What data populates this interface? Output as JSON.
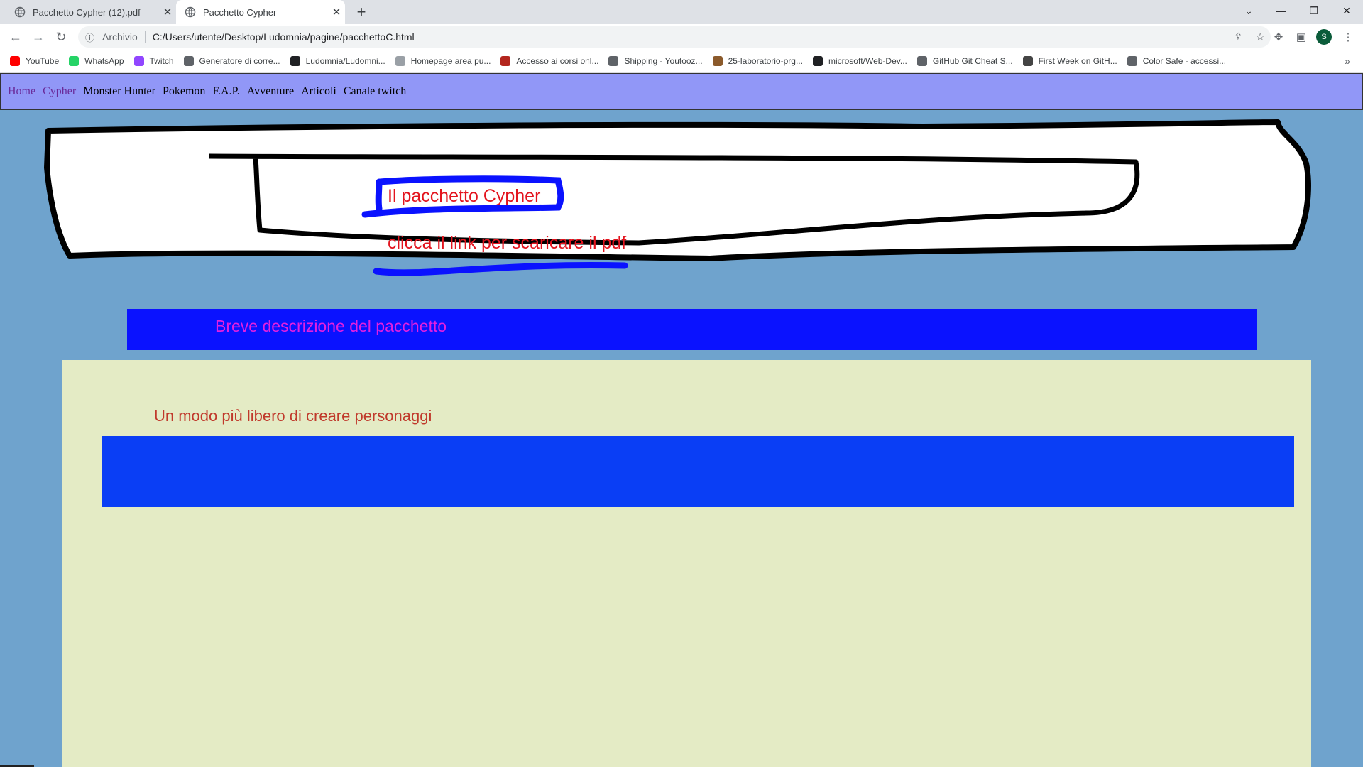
{
  "browser": {
    "tabs": [
      {
        "title": "Pacchetto Cypher (12).pdf",
        "close": "✕"
      },
      {
        "title": "Pacchetto Cypher",
        "close": "✕"
      }
    ],
    "new_tab": "+",
    "nav": {
      "back": "←",
      "forward": "→",
      "reload": "↻"
    },
    "address": {
      "protocol_label": "Archivio",
      "url": "C:/Users/utente/Desktop/Ludomnia/pagine/pacchettoC.html"
    },
    "profile_initial": "S",
    "bookmarks": [
      {
        "label": "YouTube",
        "icon": "youtube-icon",
        "color": "#ff0000"
      },
      {
        "label": "WhatsApp",
        "icon": "whatsapp-icon",
        "color": "#25d366"
      },
      {
        "label": "Twitch",
        "icon": "twitch-icon",
        "color": "#9146ff"
      },
      {
        "label": "Generatore di corre...",
        "icon": "globe-icon",
        "color": "#5f6368"
      },
      {
        "label": "Ludomnia/Ludomni...",
        "icon": "github-icon",
        "color": "#202124"
      },
      {
        "label": "Homepage area pu...",
        "icon": "globe-icon",
        "color": "#9aa0a6"
      },
      {
        "label": "Accesso ai corsi onl...",
        "icon": "site-icon",
        "color": "#b3261e"
      },
      {
        "label": "Shipping - Youtooz...",
        "icon": "globe-icon",
        "color": "#5f6368"
      },
      {
        "label": "25-laboratorio-prg...",
        "icon": "unimi-icon",
        "color": "#8b5a2b"
      },
      {
        "label": "microsoft/Web-Dev...",
        "icon": "github-icon",
        "color": "#202124"
      },
      {
        "label": "GitHub Git Cheat S...",
        "icon": "globe-icon",
        "color": "#5f6368"
      },
      {
        "label": "First Week on GitH...",
        "icon": "site-icon",
        "color": "#444444"
      },
      {
        "label": "Color Safe - accessi...",
        "icon": "globe-icon",
        "color": "#5f6368"
      }
    ],
    "bookmarks_more": "»"
  },
  "page": {
    "nav_links": [
      {
        "label": "Home",
        "visited": true
      },
      {
        "label": "Cypher",
        "visited": true
      },
      {
        "label": "Monster Hunter",
        "visited": false
      },
      {
        "label": "Pokemon",
        "visited": false
      },
      {
        "label": "F.A.P.",
        "visited": false
      },
      {
        "label": "Avventure",
        "visited": false
      },
      {
        "label": "Articoli",
        "visited": false
      },
      {
        "label": "Canale twitch",
        "visited": false
      }
    ],
    "banner": {
      "title": "Il pacchetto Cypher",
      "link_text": "clicca il link per scaricare il pdf"
    },
    "description_heading": "Breve descrizione del pacchetto",
    "subtitle": "Un modo più libero di creare personaggi",
    "colors": {
      "navbar": "#9197f7",
      "background": "#6fa3cd",
      "desc_bar": "#0a12ff",
      "content": "#e4ebc5",
      "inner_bar": "#0a3ef5",
      "heading_text": "#e31fe0",
      "red_text": "#e3141e"
    }
  }
}
